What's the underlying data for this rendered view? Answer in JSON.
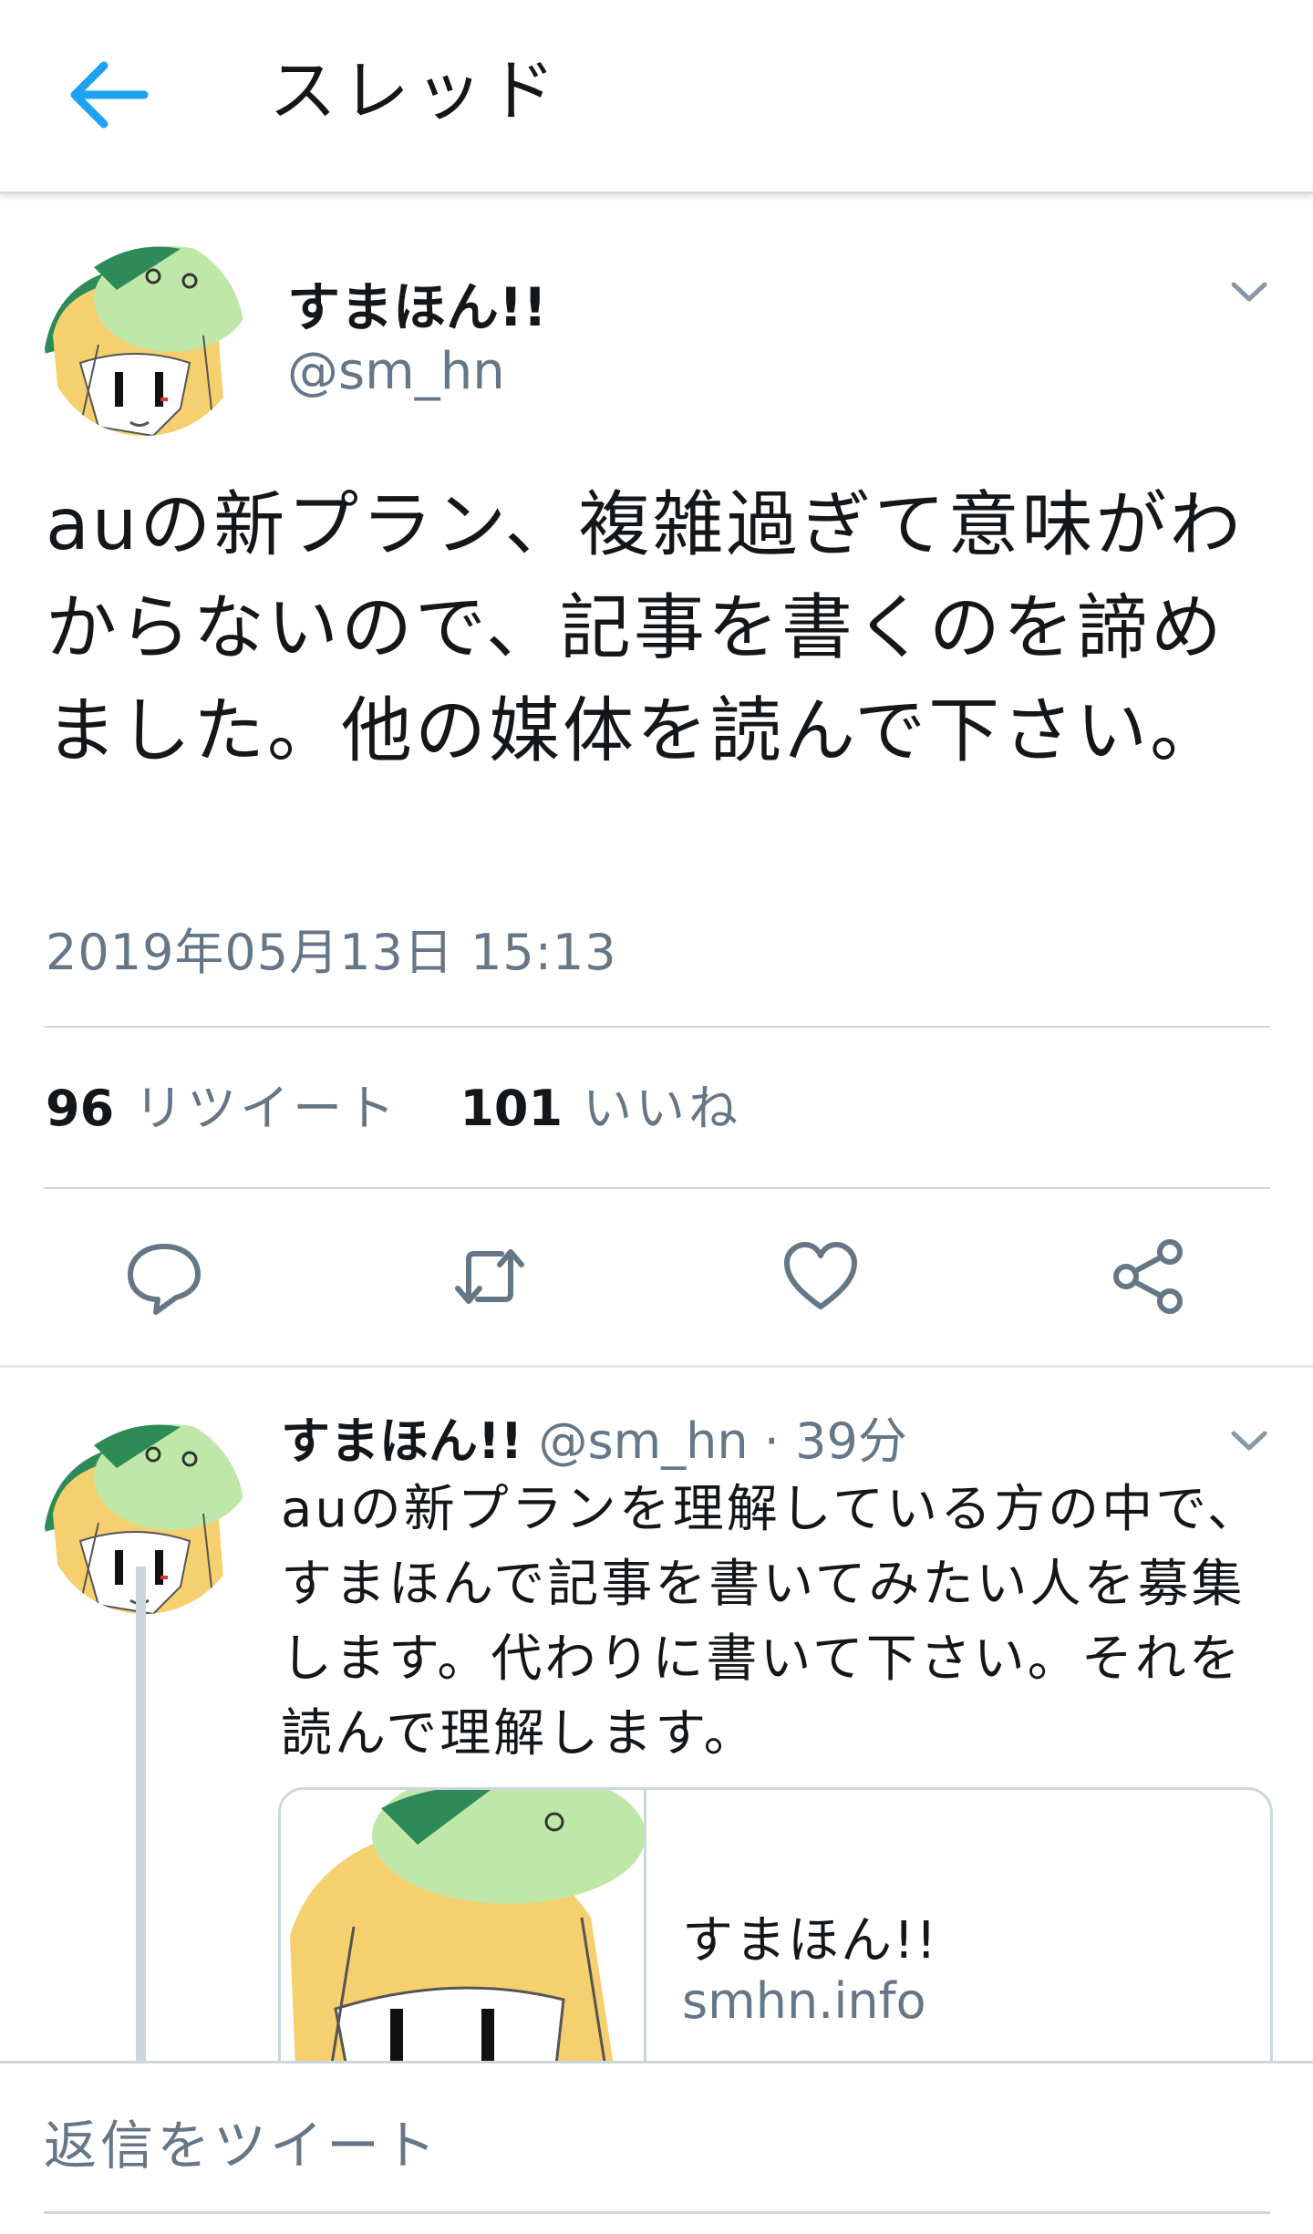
{
  "header": {
    "title": "スレッド",
    "back_icon": "arrow-left-icon",
    "accent_color": "#1da1f2"
  },
  "main_tweet": {
    "author_name": "すまほん!!",
    "author_handle": "@sm_hn",
    "text": "auの新プラン、複雑過ぎて意味がわからないので、記事を書くのを諦めました。他の媒体を読んで下さい。",
    "timestamp": "2019年05月13日 15:13",
    "retweet_count": "96",
    "retweet_label": "リツイート",
    "like_count": "101",
    "like_label": "いいね",
    "actions": [
      "reply-icon",
      "retweet-icon",
      "heart-icon",
      "share-icon"
    ]
  },
  "reply_tweet": {
    "author_name": "すまほん!!",
    "author_handle": "@sm_hn",
    "time_ago": "· 39分",
    "text": "auの新プランを理解している方の中で、すまほんで記事を書いてみたい人を募集します。代わりに書いて下さい。それを読んで理解します。",
    "card": {
      "title": "すまほん!!",
      "domain": "smhn.info"
    }
  },
  "compose": {
    "placeholder": "返信をツイート"
  }
}
